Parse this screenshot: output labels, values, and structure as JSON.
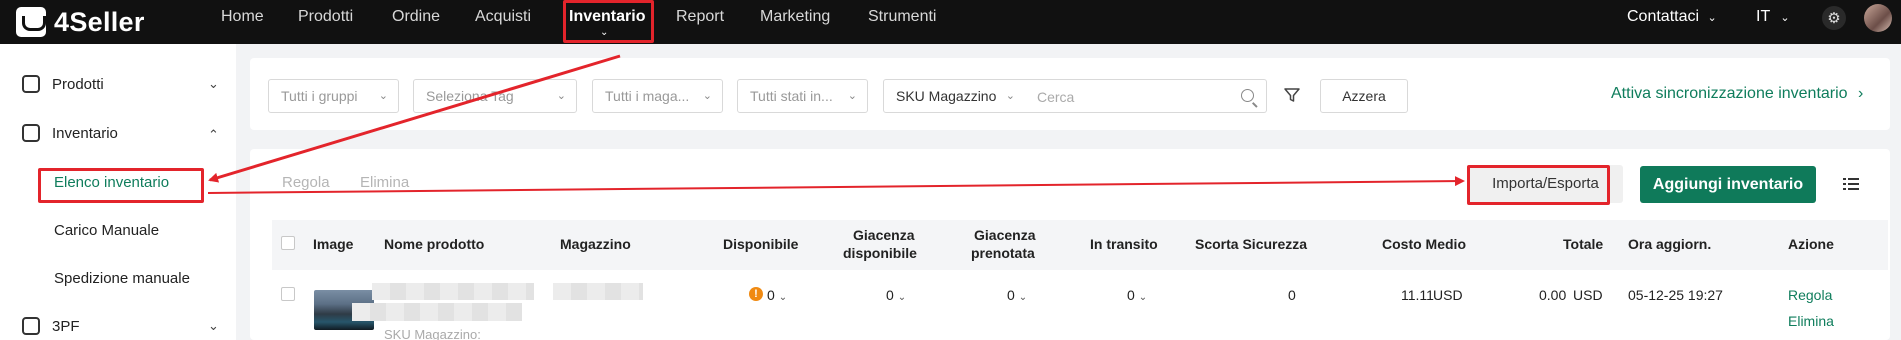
{
  "app": {
    "logo_text": "4Seller"
  },
  "topnav": {
    "items": [
      "Home",
      "Prodotti",
      "Ordine",
      "Acquisti",
      "Inventario",
      "Report",
      "Marketing",
      "Strumenti"
    ],
    "active": "Inventario",
    "contact_label": "Contattaci",
    "language_label": "IT"
  },
  "sidebar": {
    "prodotti": "Prodotti",
    "inventario": "Inventario",
    "sub_items": [
      "Elenco inventario",
      "Carico Manuale",
      "Spedizione manuale"
    ],
    "active_sub": "Elenco inventario",
    "tpf": "3PF"
  },
  "filters": {
    "groups_placeholder": "Tutti i gruppi",
    "tag_placeholder": "Seleziona Tag",
    "warehouse_placeholder": "Tutti i maga...",
    "status_placeholder": "Tutti stati in...",
    "search_field": "SKU Magazzino",
    "search_placeholder": "Cerca",
    "reset_label": "Azzera",
    "sync_label": "Attiva sincronizzazione inventario"
  },
  "toolbar": {
    "tab_regola": "Regola",
    "tab_elimina": "Elimina",
    "import_export_label": "Importa/Esporta",
    "add_inventory_label": "Aggiungi inventario"
  },
  "table": {
    "headers": {
      "image": "Image",
      "product_name": "Nome prodotto",
      "warehouse": "Magazzino",
      "available": "Disponibile",
      "stock_available_1": "Giacenza",
      "stock_available_2": "disponibile",
      "stock_reserved_1": "Giacenza",
      "stock_reserved_2": "prenotata",
      "in_transit": "In transito",
      "safety_stock": "Scorta Sicurezza",
      "avg_cost": "Costo Medio",
      "total": "Totale",
      "updated": "Ora aggiorn.",
      "action": "Azione"
    },
    "rows": [
      {
        "available": "0",
        "stock_available": "0",
        "stock_reserved": "0",
        "in_transit": "0",
        "safety_stock": "0",
        "avg_cost": "11.11",
        "avg_cost_currency": "USD",
        "total": "0.00",
        "total_currency": "USD",
        "updated": "05-12-25 19:27",
        "action_adjust": "Regola",
        "action_delete": "Elimina",
        "sku_hint": "SKU Magazzino:"
      }
    ]
  },
  "colors": {
    "brand_green": "#0f7d5c",
    "annotation_red": "#e3242b",
    "topbar_bg": "#111111"
  }
}
